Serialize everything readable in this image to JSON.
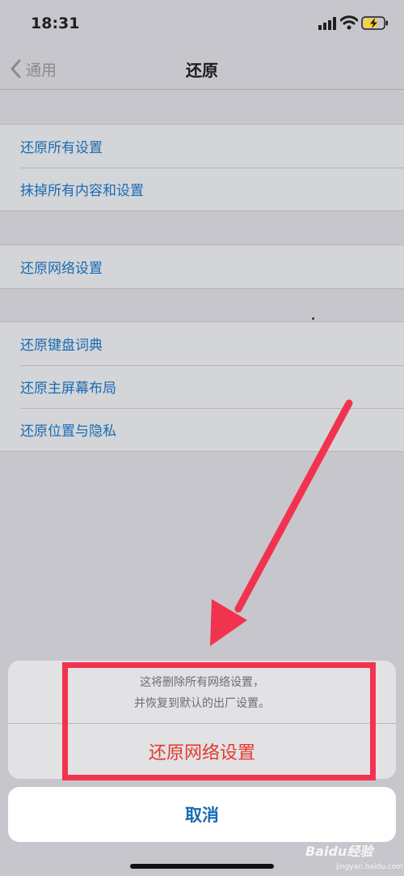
{
  "status_bar": {
    "time": "18:31"
  },
  "nav": {
    "back_label": "通用",
    "title": "还原"
  },
  "groups": [
    {
      "items": [
        {
          "label": "还原所有设置"
        },
        {
          "label": "抹掉所有内容和设置"
        }
      ]
    },
    {
      "items": [
        {
          "label": "还原网络设置"
        }
      ]
    },
    {
      "items": [
        {
          "label": "还原键盘词典"
        },
        {
          "label": "还原主屏幕布局"
        },
        {
          "label": "还原位置与隐私"
        }
      ]
    }
  ],
  "action_sheet": {
    "message_line1": "这将删除所有网络设置，",
    "message_line2": "并恢复到默认的出厂设置。",
    "destructive_label": "还原网络设置",
    "cancel_label": "取消"
  },
  "annotation": {
    "color": "#f2334f"
  },
  "watermark": {
    "brand": "Baidu经验",
    "url": "jingyan.baidu.com"
  },
  "colors": {
    "link": "#1a6bb3",
    "destructive": "#e5392f",
    "background": "#c7c6cc"
  }
}
